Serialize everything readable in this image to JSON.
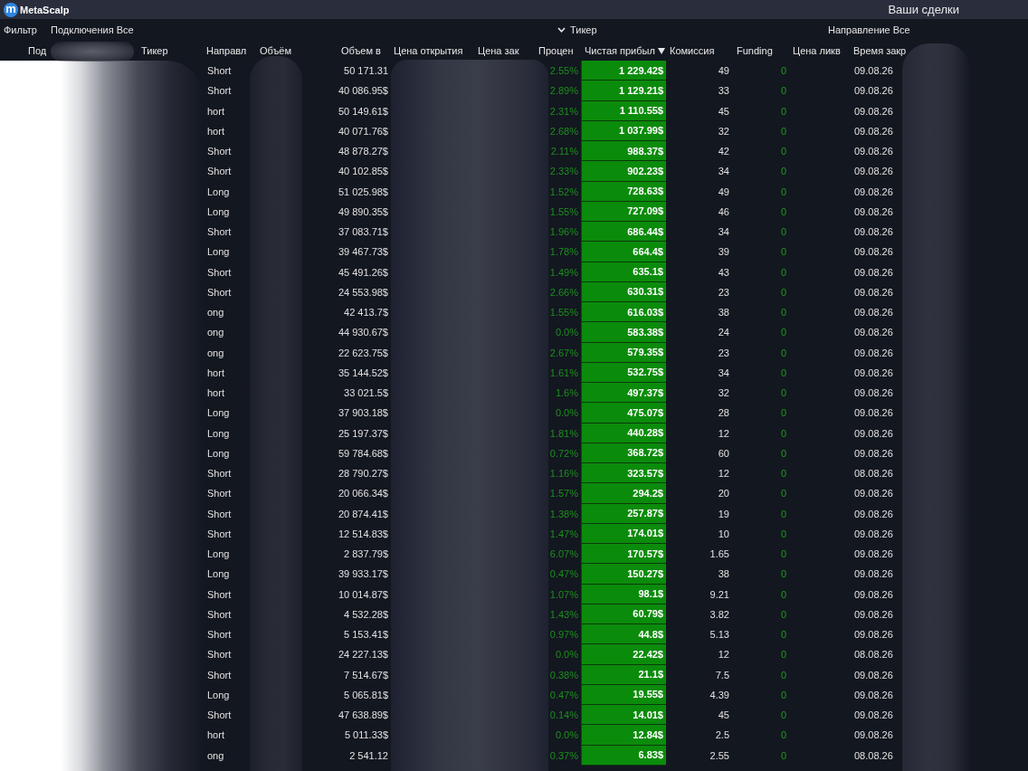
{
  "window": {
    "logo_glyph": "m",
    "app_name": "MetaScalp",
    "title": "Ваши сделки"
  },
  "filter_bar": {
    "label": "Фильтр",
    "filters": [
      {
        "kind": "value",
        "label": "Подключения",
        "value": "Все"
      },
      {
        "kind": "dropdown",
        "label": "Тикер"
      },
      {
        "kind": "value",
        "label": "Направление",
        "value": "Все"
      }
    ]
  },
  "table": {
    "columns": [
      {
        "label": "Под",
        "sorted": false
      },
      {
        "label": "Тикер",
        "sorted": false
      },
      {
        "label": "Направл",
        "sorted": false
      },
      {
        "label": "Объём",
        "sorted": false
      },
      {
        "label": "Объем в",
        "sorted": false
      },
      {
        "label": "Цена открытия",
        "sorted": false
      },
      {
        "label": "Цена зак",
        "sorted": false
      },
      {
        "label": "Процен",
        "sorted": false
      },
      {
        "label": "Чистая прибыл",
        "sorted": true
      },
      {
        "label": "Комиссия",
        "sorted": false
      },
      {
        "label": "Funding",
        "sorted": false
      },
      {
        "label": "Цена ликв",
        "sorted": false
      },
      {
        "label": "Время закр",
        "sorted": false
      }
    ],
    "rows": [
      {
        "direction": "Short",
        "volume": "50 171.31",
        "percent": "2.55%",
        "net_profit": "1 229.42$",
        "commission": "49",
        "funding": "0",
        "close_time": "09.08.26"
      },
      {
        "direction": "Short",
        "volume": "40 086.95$",
        "percent": "2.89%",
        "net_profit": "1 129.21$",
        "commission": "33",
        "funding": "0",
        "close_time": "09.08.26"
      },
      {
        "direction": "hort",
        "volume": "50 149.61$",
        "percent": "2.31%",
        "net_profit": "1 110.55$",
        "commission": "45",
        "funding": "0",
        "close_time": "09.08.26"
      },
      {
        "direction": "hort",
        "volume": "40 071.76$",
        "percent": "2.68%",
        "net_profit": "1 037.99$",
        "commission": "32",
        "funding": "0",
        "close_time": "09.08.26"
      },
      {
        "direction": "Short",
        "volume": "48 878.27$",
        "percent": "2.11%",
        "net_profit": "988.37$",
        "commission": "42",
        "funding": "0",
        "close_time": "09.08.26"
      },
      {
        "direction": "Short",
        "volume": "40 102.85$",
        "percent": "2.33%",
        "net_profit": "902.23$",
        "commission": "34",
        "funding": "0",
        "close_time": "09.08.26"
      },
      {
        "direction": "Long",
        "volume": "51 025.98$",
        "percent": "1.52%",
        "net_profit": "728.63$",
        "commission": "49",
        "funding": "0",
        "close_time": "09.08.26"
      },
      {
        "direction": "Long",
        "volume": "49 890.35$",
        "percent": "1.55%",
        "net_profit": "727.09$",
        "commission": "46",
        "funding": "0",
        "close_time": "09.08.26"
      },
      {
        "direction": "Short",
        "volume": "37 083.71$",
        "percent": "1.96%",
        "net_profit": "686.44$",
        "commission": "34",
        "funding": "0",
        "close_time": "09.08.26"
      },
      {
        "direction": "Long",
        "volume": "39 467.73$",
        "percent": "1.78%",
        "net_profit": "664.4$",
        "commission": "39",
        "funding": "0",
        "close_time": "09.08.26"
      },
      {
        "direction": "Short",
        "volume": "45 491.26$",
        "percent": "1.49%",
        "net_profit": "635.1$",
        "commission": "43",
        "funding": "0",
        "close_time": "09.08.26"
      },
      {
        "direction": "Short",
        "volume": "24 553.98$",
        "percent": "2.66%",
        "net_profit": "630.31$",
        "commission": "23",
        "funding": "0",
        "close_time": "09.08.26"
      },
      {
        "direction": "ong",
        "volume": "42 413.7$",
        "percent": "1.55%",
        "net_profit": "616.03$",
        "commission": "38",
        "funding": "0",
        "close_time": "09.08.26"
      },
      {
        "direction": "ong",
        "volume": "44 930.67$",
        "percent": "0.0%",
        "net_profit": "583.38$",
        "commission": "24",
        "funding": "0",
        "close_time": "09.08.26"
      },
      {
        "direction": "ong",
        "volume": "22 623.75$",
        "percent": "2.67%",
        "net_profit": "579.35$",
        "commission": "23",
        "funding": "0",
        "close_time": "09.08.26"
      },
      {
        "direction": "hort",
        "volume": "35 144.52$",
        "percent": "1.61%",
        "net_profit": "532.75$",
        "commission": "34",
        "funding": "0",
        "close_time": "09.08.26"
      },
      {
        "direction": "hort",
        "volume": "33 021.5$",
        "percent": "1.6%",
        "net_profit": "497.37$",
        "commission": "32",
        "funding": "0",
        "close_time": "09.08.26"
      },
      {
        "direction": "Long",
        "volume": "37 903.18$",
        "percent": "0.0%",
        "net_profit": "475.07$",
        "commission": "28",
        "funding": "0",
        "close_time": "09.08.26"
      },
      {
        "direction": "Long",
        "volume": "25 197.37$",
        "percent": "1.81%",
        "net_profit": "440.28$",
        "commission": "12",
        "funding": "0",
        "close_time": "09.08.26"
      },
      {
        "direction": "Long",
        "volume": "59 784.68$",
        "percent": "0.72%",
        "net_profit": "368.72$",
        "commission": "60",
        "funding": "0",
        "close_time": "09.08.26"
      },
      {
        "direction": "Short",
        "volume": "28 790.27$",
        "percent": "1.16%",
        "net_profit": "323.57$",
        "commission": "12",
        "funding": "0",
        "close_time": "08.08.26"
      },
      {
        "direction": "Short",
        "volume": "20 066.34$",
        "percent": "1.57%",
        "net_profit": "294.2$",
        "commission": "20",
        "funding": "0",
        "close_time": "09.08.26"
      },
      {
        "direction": "Short",
        "volume": "20 874.41$",
        "percent": "1.38%",
        "net_profit": "257.87$",
        "commission": "19",
        "funding": "0",
        "close_time": "09.08.26"
      },
      {
        "direction": "Short",
        "volume": "12 514.83$",
        "percent": "1.47%",
        "net_profit": "174.01$",
        "commission": "10",
        "funding": "0",
        "close_time": "09.08.26"
      },
      {
        "direction": "Long",
        "volume": "2 837.79$",
        "percent": "6.07%",
        "net_profit": "170.57$",
        "commission": "1.65",
        "funding": "0",
        "close_time": "09.08.26"
      },
      {
        "direction": "Long",
        "volume": "39 933.17$",
        "percent": "0.47%",
        "net_profit": "150.27$",
        "commission": "38",
        "funding": "0",
        "close_time": "09.08.26"
      },
      {
        "direction": "Short",
        "volume": "10 014.87$",
        "percent": "1.07%",
        "net_profit": "98.1$",
        "commission": "9.21",
        "funding": "0",
        "close_time": "09.08.26"
      },
      {
        "direction": "Short",
        "volume": "4 532.28$",
        "percent": "1.43%",
        "net_profit": "60.79$",
        "commission": "3.82",
        "funding": "0",
        "close_time": "09.08.26"
      },
      {
        "direction": "Short",
        "volume": "5 153.41$",
        "percent": "0.97%",
        "net_profit": "44.8$",
        "commission": "5.13",
        "funding": "0",
        "close_time": "09.08.26"
      },
      {
        "direction": "Short",
        "volume": "24 227.13$",
        "percent": "0.0%",
        "net_profit": "22.42$",
        "commission": "12",
        "funding": "0",
        "close_time": "08.08.26"
      },
      {
        "direction": "Short",
        "volume": "7 514.67$",
        "percent": "0.38%",
        "net_profit": "21.1$",
        "commission": "7.5",
        "funding": "0",
        "close_time": "09.08.26"
      },
      {
        "direction": "Long",
        "volume": "5 065.81$",
        "percent": "0.47%",
        "net_profit": "19.55$",
        "commission": "4.39",
        "funding": "0",
        "close_time": "09.08.26"
      },
      {
        "direction": "Short",
        "volume": "47 638.89$",
        "percent": "0.14%",
        "net_profit": "14.01$",
        "commission": "45",
        "funding": "0",
        "close_time": "09.08.26"
      },
      {
        "direction": "hort",
        "volume": "5 011.33$",
        "percent": "0.0%",
        "net_profit": "12.84$",
        "commission": "2.5",
        "funding": "0",
        "close_time": "09.08.26"
      },
      {
        "direction": "ong",
        "volume": "2 541.12",
        "percent": "0.37%",
        "net_profit": "6.83$",
        "commission": "2.55",
        "funding": "0",
        "close_time": "08.08.26"
      }
    ]
  }
}
